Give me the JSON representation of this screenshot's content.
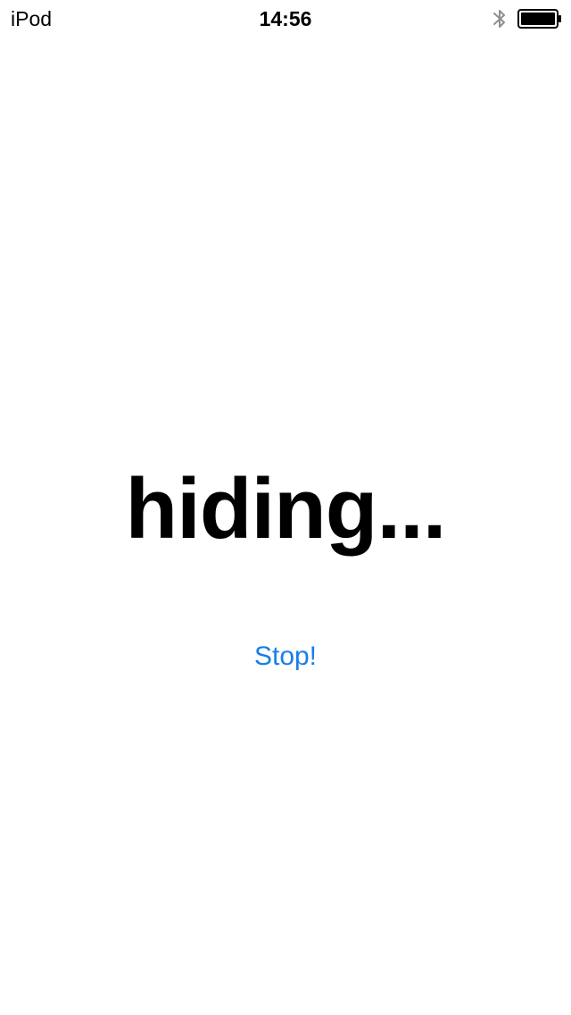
{
  "status_bar": {
    "carrier": "iPod",
    "time": "14:56",
    "bluetooth_icon": "bluetooth-icon",
    "battery_icon": "battery-full-icon"
  },
  "main": {
    "status_text": "hiding...",
    "stop_label": "Stop!",
    "accent_color": "#1a7ee6"
  }
}
